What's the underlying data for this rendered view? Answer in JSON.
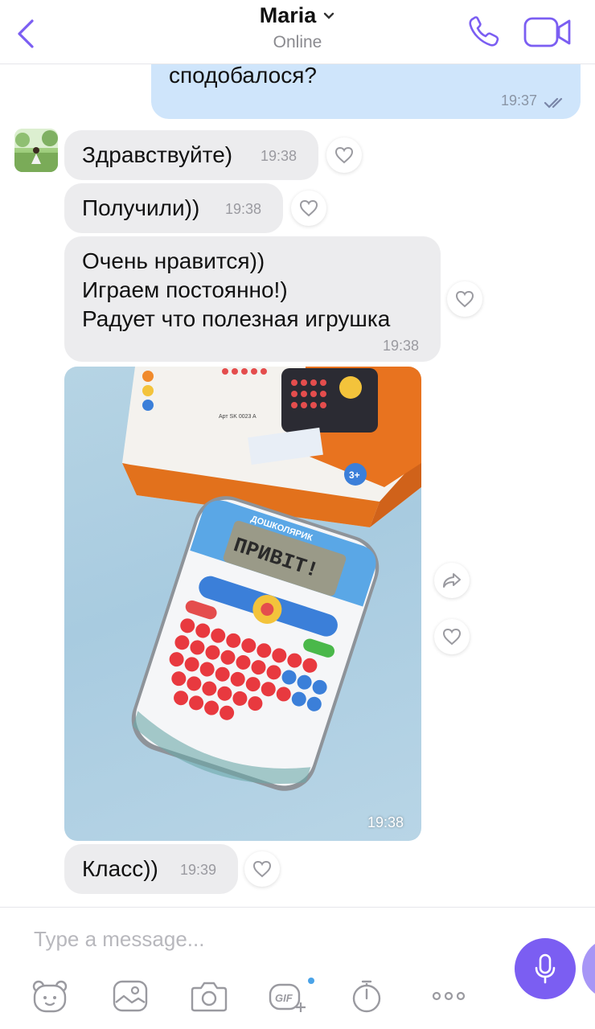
{
  "header": {
    "contact_name": "Maria",
    "status": "Online"
  },
  "messages": {
    "outgoing_text": "сподобалося?",
    "outgoing_time": "19:37",
    "m1_text": "Здравствуйте)",
    "m1_time": "19:38",
    "m2_text": "Получили))",
    "m2_time": "19:38",
    "m3_line1": "Очень нравится))",
    "m3_line2": "Играем постоянно!)",
    "m3_line3": "Радует что полезная игрушка",
    "m3_time": "19:38",
    "photo_time": "19:38",
    "photo_screen_text": "ПРИВІТ!",
    "photo_device_brand": "ДОШКОЛЯРИК",
    "photo_box_art": "Арт SK 0023 A",
    "photo_age_badge": "3+",
    "m5_text": "Класс))",
    "m5_time": "19:39"
  },
  "composer": {
    "placeholder": "Type a message..."
  },
  "colors": {
    "accent": "#7b5ef2",
    "outgoing_bubble": "#cfe5fb",
    "incoming_bubble": "#ececee"
  }
}
